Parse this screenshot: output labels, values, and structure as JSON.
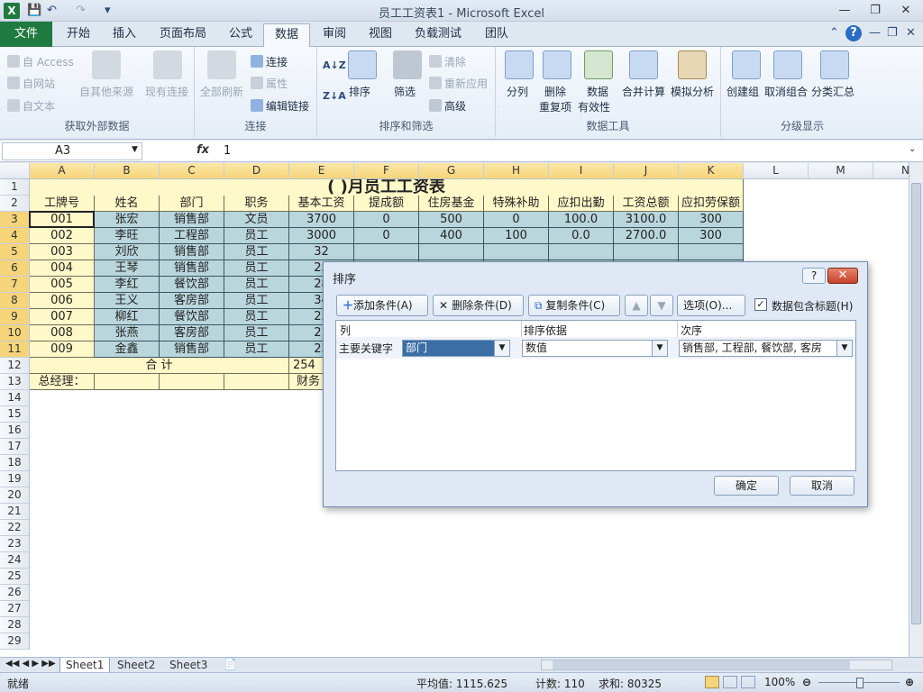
{
  "window": {
    "title": "员工工资表1 - Microsoft Excel",
    "app_icon": "X",
    "minimize": "—",
    "restore": "❐",
    "close": "✕"
  },
  "ribbon_tabs": [
    "文件",
    "开始",
    "插入",
    "页面布局",
    "公式",
    "数据",
    "审阅",
    "视图",
    "负载测试",
    "团队"
  ],
  "ribbon": {
    "external": {
      "access": "自 Access",
      "web": "自网站",
      "text": "自文本",
      "other": "自其他来源",
      "existing": "现有连接",
      "label": "获取外部数据"
    },
    "connections": {
      "refresh_all": "全部刷新",
      "connections": "连接",
      "properties": "属性",
      "edit_links": "编辑链接",
      "label": "连接"
    },
    "sortfilter": {
      "sort": "排序",
      "filter": "筛选",
      "clear": "清除",
      "reapply": "重新应用",
      "advanced": "高级",
      "label": "排序和筛选",
      "az": "A↓Z",
      "za": "Z↓A"
    },
    "datatools": {
      "split": "分列",
      "remove_dup_1": "删除",
      "remove_dup_2": "重复项",
      "validation_1": "数据",
      "validation_2": "有效性",
      "consolidate": "合并计算",
      "whatif": "模拟分析",
      "label": "数据工具"
    },
    "outline": {
      "group": "创建组",
      "ungroup": "取消组合",
      "subtotal": "分类汇总",
      "label": "分级显示"
    }
  },
  "formula_bar": {
    "name_box": "A3",
    "fx": "fx",
    "value": "1"
  },
  "columns": [
    "A",
    "B",
    "C",
    "D",
    "E",
    "F",
    "G",
    "H",
    "I",
    "J",
    "K",
    "L",
    "M",
    "N"
  ],
  "rows": [
    "1",
    "2",
    "3",
    "4",
    "5",
    "6",
    "7",
    "8",
    "9",
    "10",
    "11",
    "12",
    "13",
    "14",
    "15",
    "16",
    "17",
    "18",
    "19",
    "20",
    "21",
    "22",
    "23",
    "24",
    "25",
    "26",
    "27",
    "28",
    "29"
  ],
  "sheet": {
    "title": "( )月员工工资表",
    "headers": [
      "工牌号",
      "姓名",
      "部门",
      "职务",
      "基本工资",
      "提成额",
      "住房基金",
      "特殊补助",
      "应扣出勤",
      "工资总额",
      "应扣劳保额"
    ],
    "data": [
      [
        "001",
        "张宏",
        "销售部",
        "文员",
        "3700",
        "0",
        "500",
        "0",
        "100.0",
        "3100.0",
        "300"
      ],
      [
        "002",
        "李旺",
        "工程部",
        "员工",
        "3000",
        "0",
        "400",
        "100",
        "0.0",
        "2700.0",
        "300"
      ],
      [
        "003",
        "刘欣",
        "销售部",
        "员工",
        "32",
        "",
        "",
        "",
        "",
        "",
        ""
      ],
      [
        "004",
        "王琴",
        "销售部",
        "员工",
        "25",
        "",
        "",
        "",
        "",
        "",
        ""
      ],
      [
        "005",
        "李红",
        "餐饮部",
        "员工",
        "28",
        "",
        "",
        "",
        "",
        "",
        ""
      ],
      [
        "006",
        "王义",
        "客房部",
        "员工",
        "34",
        "",
        "",
        "",
        "",
        "",
        ""
      ],
      [
        "007",
        "柳红",
        "餐饮部",
        "员工",
        "23",
        "",
        "",
        "",
        "",
        "",
        ""
      ],
      [
        "008",
        "张燕",
        "客房部",
        "员工",
        "21",
        "",
        "",
        "",
        "",
        "",
        ""
      ],
      [
        "009",
        "金鑫",
        "销售部",
        "员工",
        "23",
        "",
        "",
        "",
        "",
        "",
        ""
      ]
    ],
    "total_label": "合  计",
    "total_value": "254",
    "manager_label": "总经理：",
    "finance_label": "财务"
  },
  "sheet_tabs": [
    "Sheet1",
    "Sheet2",
    "Sheet3"
  ],
  "status": {
    "ready": "就绪",
    "average": "平均值: 1115.625",
    "count": "计数: 110",
    "sum": "求和: 80325",
    "zoom": "100%"
  },
  "dialog": {
    "title": "排序",
    "help": "?",
    "close": "✕",
    "add_level": "添加条件(A)",
    "delete_level": "删除条件(D)",
    "copy_level": "复制条件(C)",
    "move_up": "▲",
    "move_down": "▼",
    "options": "选项(O)...",
    "has_headers": "数据包含标题(H)",
    "col_header": "列",
    "sort_on_header": "排序依据",
    "order_header": "次序",
    "primary_key_label": "主要关键字",
    "primary_key_value": "部门",
    "sort_on_value": "数值",
    "order_value": "销售部, 工程部, 餐饮部, 客房",
    "ok": "确定",
    "cancel": "取消"
  },
  "colors": {
    "excel_green": "#1f7a3f",
    "header_yellow": "#fff8c8",
    "data_teal": "#b9d6dc",
    "selected_header": "#f6d47a"
  }
}
